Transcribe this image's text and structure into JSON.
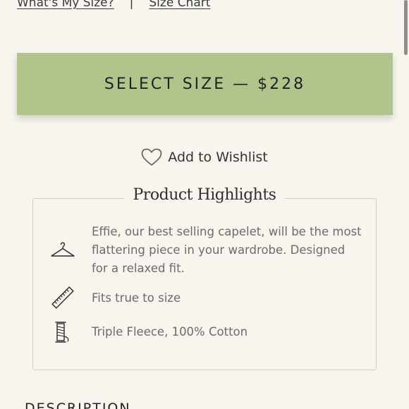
{
  "size_links": {
    "whats_my_size": "What's My Size?",
    "separator": "|",
    "size_chart": "Size Chart"
  },
  "select_button": {
    "label": "SELECT SIZE — $228"
  },
  "wishlist": {
    "label": "Add to Wishlist"
  },
  "highlights": {
    "title": "Product Highlights",
    "items": [
      {
        "icon": "hanger-icon",
        "text": "Effie, our best selling capelet, will be the most flattering piece in your wardrobe. Designed for a relaxed fit."
      },
      {
        "icon": "ruler-icon",
        "text": "Fits true to size"
      },
      {
        "icon": "spool-icon",
        "text": "Triple Fleece, 100% Cotton"
      }
    ]
  },
  "description": {
    "heading": "DESCRIPTION"
  },
  "colors": {
    "background": "#f7f5ee",
    "button": "#b1c48b",
    "text_muted": "#6b6b6b"
  }
}
